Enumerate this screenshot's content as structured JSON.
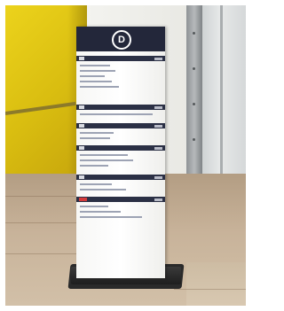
{
  "sign": {
    "badge_letter": "D",
    "colors": {
      "header": "#23273a",
      "panel": "#ffffff",
      "accent_red": "#d43a3a"
    }
  },
  "environment": {
    "colors": {
      "yellow_wall": "#e2c615",
      "pillar": "#9ea2a5",
      "floor": "#c8b39a"
    }
  }
}
